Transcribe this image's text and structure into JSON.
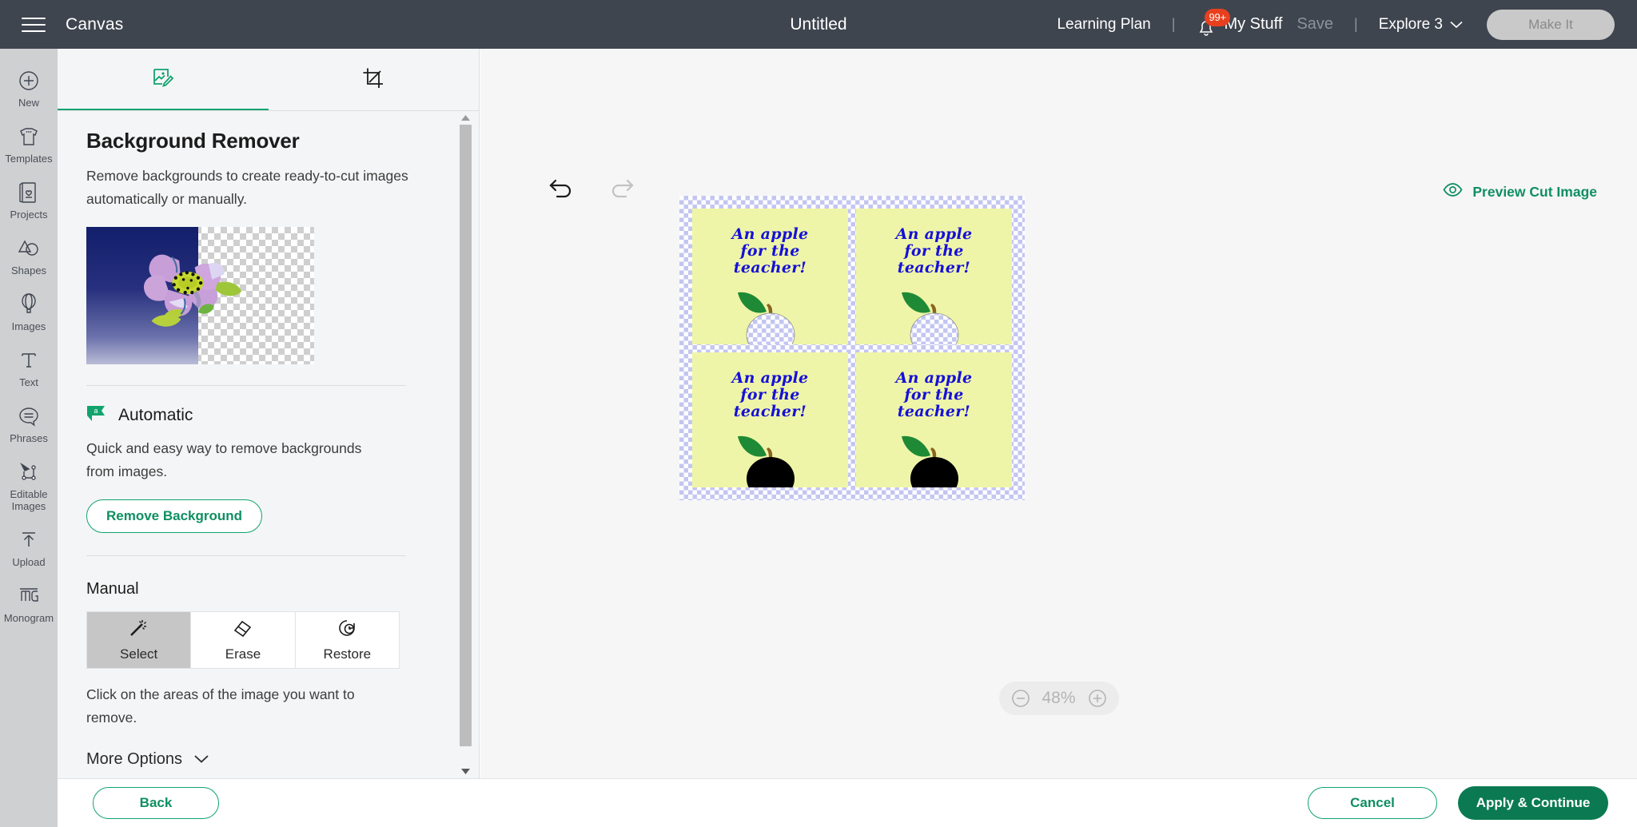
{
  "topbar": {
    "menu_icon": "hamburger-icon",
    "app_label": "Canvas",
    "project_title": "Untitled",
    "learning_plan": "Learning Plan",
    "separator": "|",
    "notification_badge": "99+",
    "my_stuff": "My Stuff",
    "save": "Save",
    "explore": "Explore 3",
    "make_it": "Make It",
    "bg": "#3f454f"
  },
  "sidebar": {
    "items": [
      {
        "label": "New",
        "icon": "plus-circle-icon"
      },
      {
        "label": "Templates",
        "icon": "tshirt-icon"
      },
      {
        "label": "Projects",
        "icon": "card-heart-icon"
      },
      {
        "label": "Shapes",
        "icon": "shapes-icon"
      },
      {
        "label": "Images",
        "icon": "hot-air-balloon-icon"
      },
      {
        "label": "Text",
        "icon": "text-t-icon"
      },
      {
        "label": "Phrases",
        "icon": "speech-bubble-icon"
      },
      {
        "label": "Editable Images",
        "icon": "editable-nodes-icon"
      },
      {
        "label": "Upload",
        "icon": "upload-arrow-icon"
      },
      {
        "label": "Monogram",
        "icon": "monogram-mg-icon"
      }
    ]
  },
  "panel": {
    "tabs": [
      {
        "name": "edit-image-tab",
        "icon": "image-pencil-icon",
        "active": true
      },
      {
        "name": "crop-tab",
        "icon": "crop-icon",
        "active": false
      }
    ],
    "title": "Background Remover",
    "description": "Remove backgrounds to create ready-to-cut images automatically or manually.",
    "preview_alt": "flower-before-after-preview",
    "automatic": {
      "badge_letter": "a",
      "title": "Automatic",
      "description": "Quick and easy way to remove backgrounds from images.",
      "button": "Remove Background"
    },
    "manual": {
      "title": "Manual",
      "tools": [
        {
          "label": "Select",
          "icon": "magic-wand-icon",
          "selected": true
        },
        {
          "label": "Erase",
          "icon": "eraser-icon",
          "selected": false
        },
        {
          "label": "Restore",
          "icon": "restore-clock-icon",
          "selected": false
        }
      ],
      "hint": "Click on the areas of the image you want to remove."
    },
    "more_options": "More Options",
    "accent": "#11a36e"
  },
  "canvas": {
    "undo_icon": "undo-arrow-icon",
    "redo_icon": "redo-arrow-icon",
    "preview_cut_label": "Preview Cut Image",
    "preview_cut_icon": "eye-icon",
    "zoom_level": "48%",
    "zoom_out_icon": "minus-circle-icon",
    "zoom_in_icon": "plus-circle-icon",
    "cards": [
      {
        "text_lines": [
          "An apple",
          "for the",
          "teacher!"
        ],
        "apple_body": "transparent"
      },
      {
        "text_lines": [
          "An apple",
          "for the",
          "teacher!"
        ],
        "apple_body": "transparent"
      },
      {
        "text_lines": [
          "An apple",
          "for the",
          "teacher!"
        ],
        "apple_body": "black"
      },
      {
        "text_lines": [
          "An apple",
          "for the",
          "teacher!"
        ],
        "apple_body": "black"
      }
    ],
    "card_bg": "#eff5a8",
    "text_color": "#1510d8",
    "leaf_color": "#1f8a35",
    "stem_color": "#8a6421"
  },
  "bottombar": {
    "back": "Back",
    "cancel": "Cancel",
    "apply": "Apply & Continue"
  }
}
